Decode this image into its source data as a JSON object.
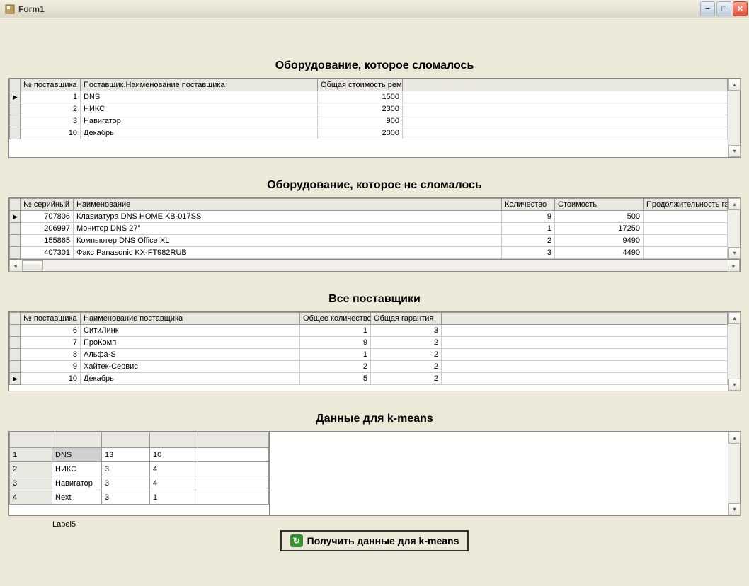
{
  "window": {
    "title": "Form1"
  },
  "section1": {
    "title": "Оборудование, которое сломалось",
    "columns": [
      "№ поставщика",
      "Поставщик.Наименование поставщика",
      "Общая стоимость ремонта"
    ],
    "rows": [
      {
        "num": "1",
        "name": "DNS",
        "cost": "1500",
        "pointer": true
      },
      {
        "num": "2",
        "name": "НИКС",
        "cost": "2300",
        "pointer": false
      },
      {
        "num": "3",
        "name": "Навигатор",
        "cost": "900",
        "pointer": false
      },
      {
        "num": "10",
        "name": "Декабрь",
        "cost": "2000",
        "pointer": false
      }
    ]
  },
  "section2": {
    "title": "Оборудование, которое не сломалось",
    "columns": [
      "№ серийный",
      "Наименование",
      "Количество",
      "Стоимость",
      "Продолжительность гаран"
    ],
    "rows": [
      {
        "serial": "707806",
        "name": "Клавиатура DNS HOME KB-017SS",
        "qty": "9",
        "cost": "500",
        "warr": "",
        "pointer": true
      },
      {
        "serial": "206997",
        "name": "Монитор DNS 27''",
        "qty": "1",
        "cost": "17250",
        "warr": "",
        "pointer": false
      },
      {
        "serial": "155865",
        "name": "Компьютер DNS Office XL",
        "qty": "2",
        "cost": "9490",
        "warr": "",
        "pointer": false
      },
      {
        "serial": "407301",
        "name": "Факс Panasonic KX-FT982RUB",
        "qty": "3",
        "cost": "4490",
        "warr": "",
        "pointer": false
      }
    ]
  },
  "section3": {
    "title": "Все поставщики",
    "columns": [
      "№ поставщика",
      "Наименование поставщика",
      "Общее количество",
      "Общая гарантия"
    ],
    "rows": [
      {
        "num": "6",
        "name": "СитиЛинк",
        "qty": "1",
        "warr": "3",
        "pointer": false
      },
      {
        "num": "7",
        "name": "ПроКомп",
        "qty": "9",
        "warr": "2",
        "pointer": false
      },
      {
        "num": "8",
        "name": "Альфа-S",
        "qty": "1",
        "warr": "2",
        "pointer": false
      },
      {
        "num": "9",
        "name": "Хайтек-Сервис",
        "qty": "2",
        "warr": "2",
        "pointer": false
      },
      {
        "num": "10",
        "name": "Декабрь",
        "qty": "5",
        "warr": "2",
        "pointer": true
      }
    ]
  },
  "section4": {
    "title": "Данные для k-means",
    "rows": [
      {
        "c0": "1",
        "c1": "DNS",
        "c2": "13",
        "c3": "10",
        "selected": true
      },
      {
        "c0": "2",
        "c1": "НИКС",
        "c2": "3",
        "c3": "4",
        "selected": false
      },
      {
        "c0": "3",
        "c1": "Навигатор",
        "c2": "3",
        "c3": "4",
        "selected": false
      },
      {
        "c0": "4",
        "c1": "Next",
        "c2": "3",
        "c3": "1",
        "selected": false
      }
    ]
  },
  "label5": "Label5",
  "button": {
    "label": "Получить данные для k-means"
  }
}
